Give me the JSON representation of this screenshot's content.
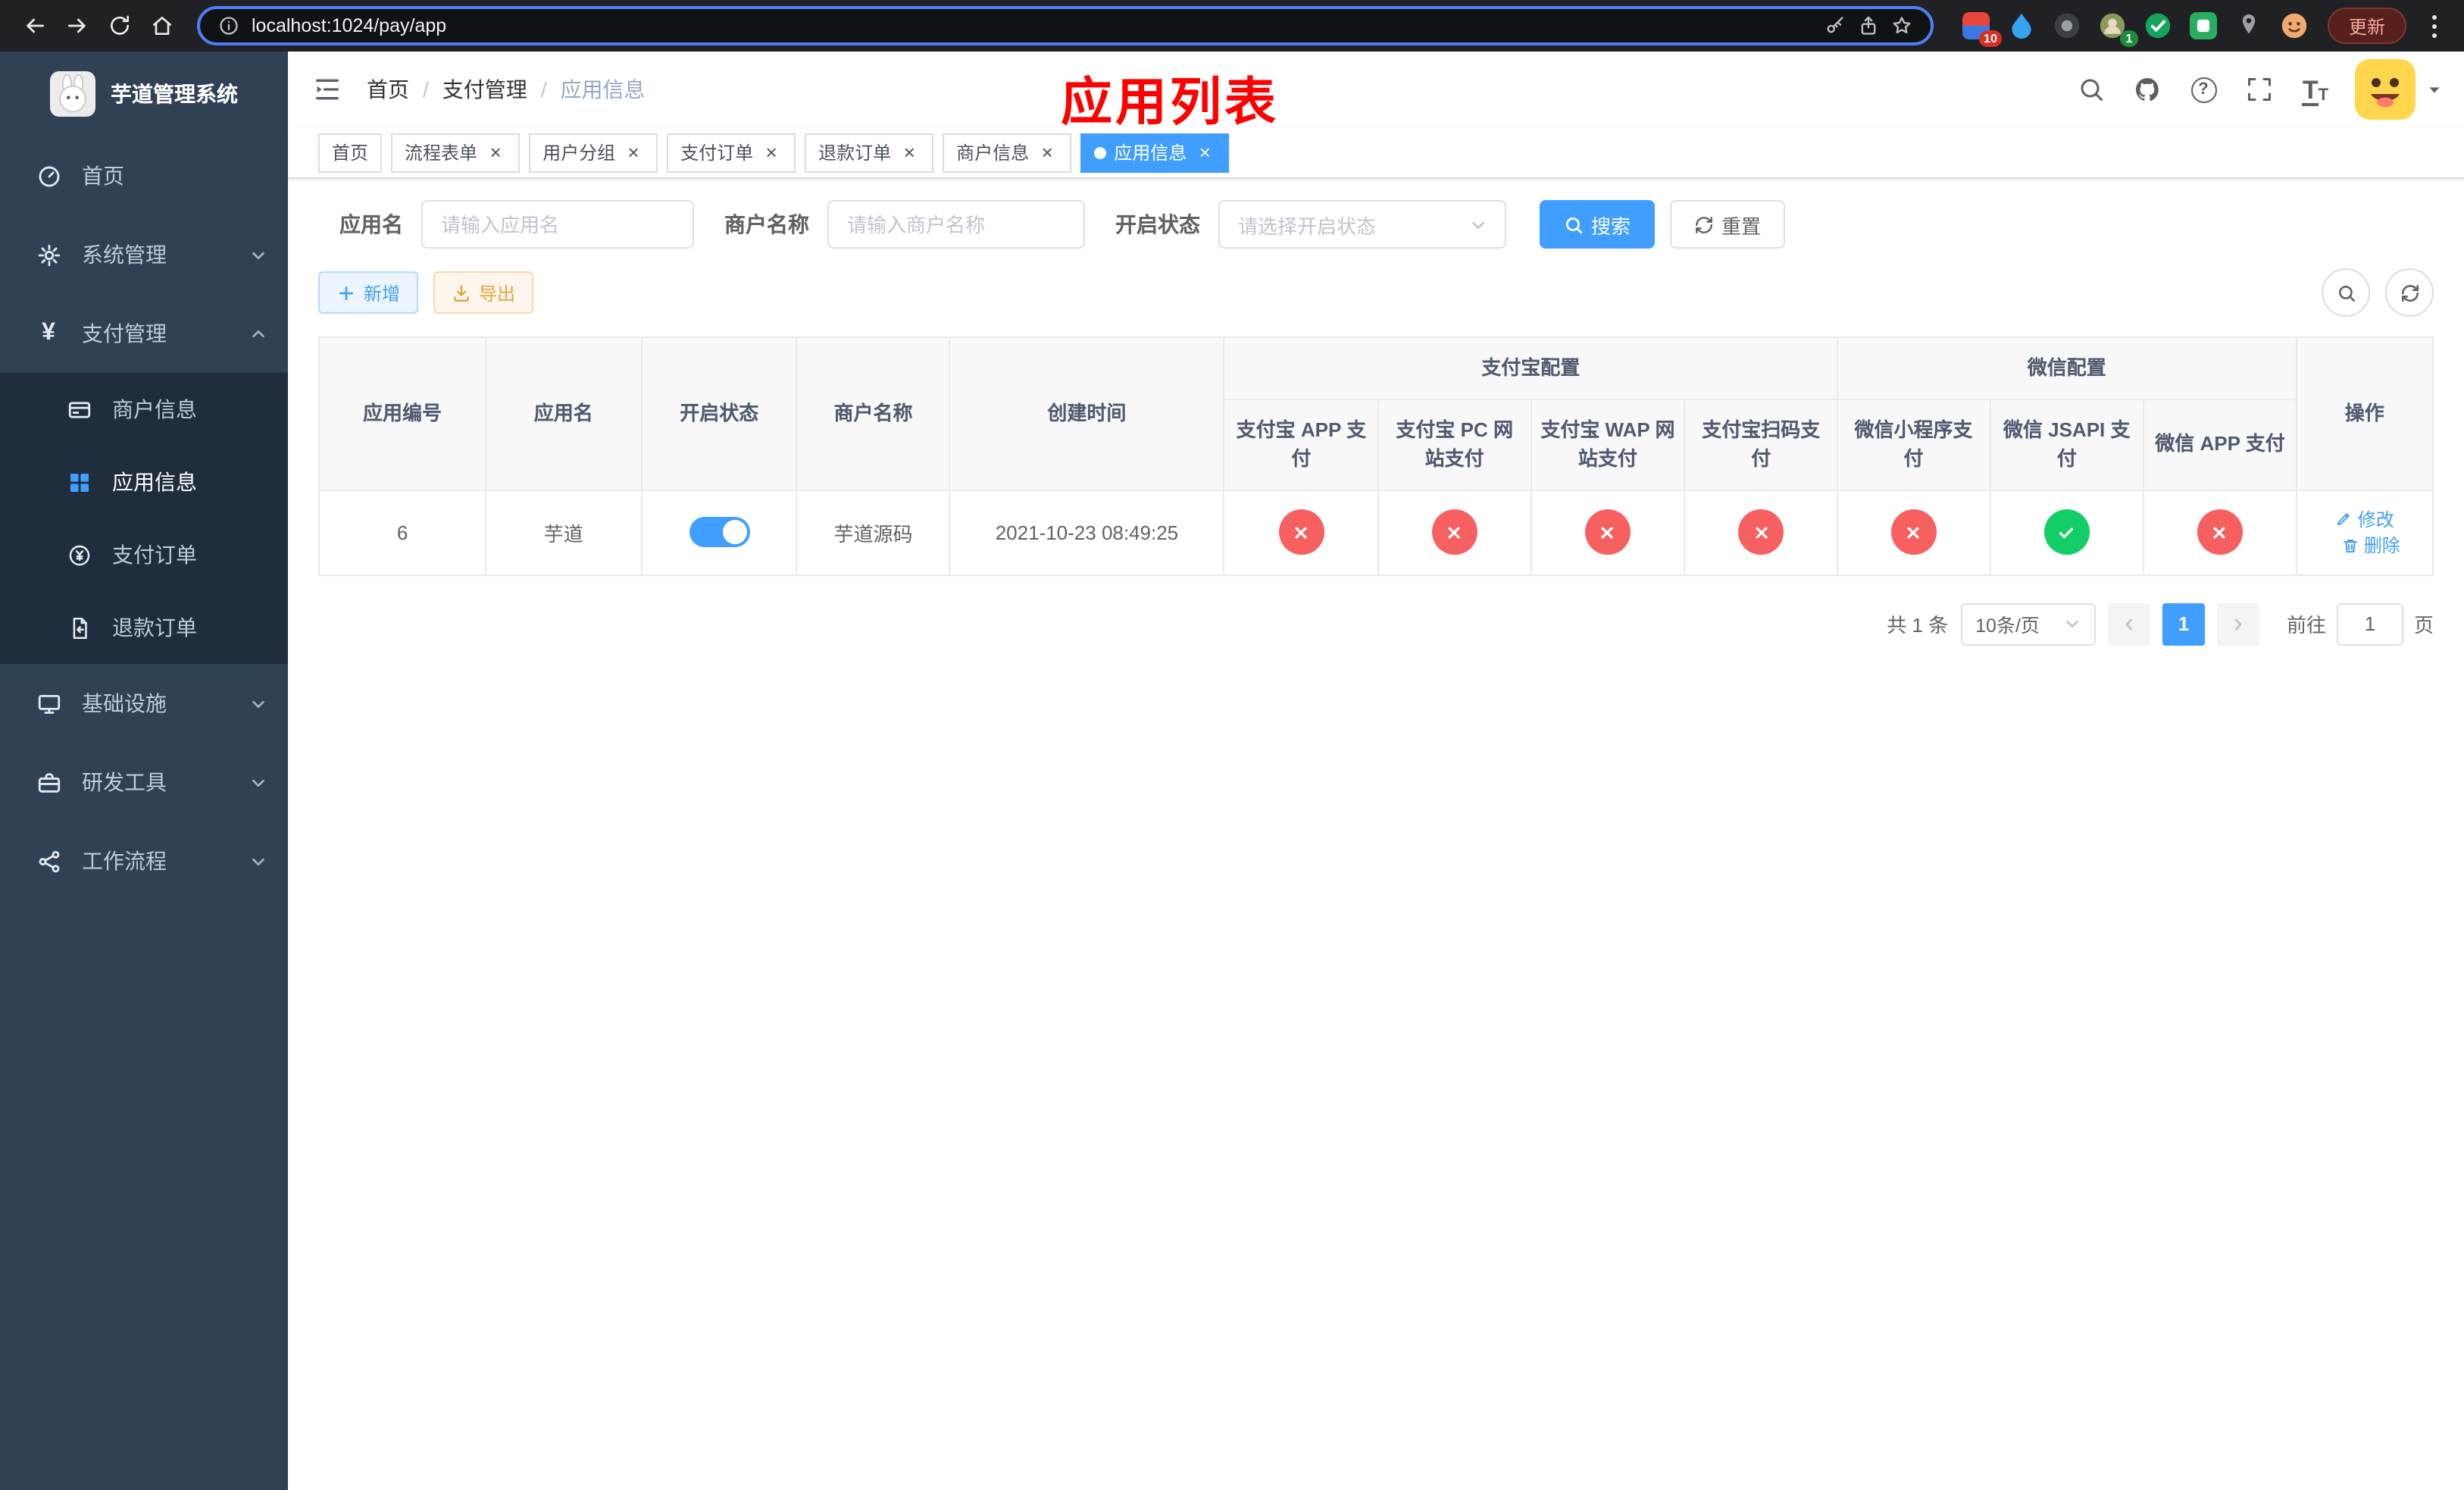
{
  "colors": {
    "accent": "#409eff",
    "success": "#13ce66",
    "danger": "#f76060",
    "warning": "#e6a23c",
    "sidebar-bg": "#304156",
    "submenu-bg": "#1f2d3d",
    "annotation": "#ff0000"
  },
  "icons": {
    "close": "×",
    "yen": "¥",
    "question": "?",
    "font": "T",
    "breadcrumb_sep": "/"
  },
  "browser": {
    "url": "localhost:1024/pay/app",
    "update_label": "更新",
    "ext_badges": [
      "10",
      "1"
    ]
  },
  "annotation": "应用列表",
  "sidebar": {
    "title": "芋道管理系统",
    "menu": [
      {
        "label": "首页"
      },
      {
        "label": "系统管理"
      },
      {
        "label": "支付管理",
        "children": [
          {
            "label": "商户信息"
          },
          {
            "label": "应用信息",
            "active": true
          },
          {
            "label": "支付订单"
          },
          {
            "label": "退款订单"
          }
        ]
      },
      {
        "label": "基础设施"
      },
      {
        "label": "研发工具"
      },
      {
        "label": "工作流程"
      }
    ]
  },
  "header": {
    "breadcrumb": [
      "首页",
      "支付管理",
      "应用信息"
    ]
  },
  "tags": [
    {
      "label": "首页",
      "closable": false,
      "active": false
    },
    {
      "label": "流程表单",
      "closable": true,
      "active": false
    },
    {
      "label": "用户分组",
      "closable": true,
      "active": false
    },
    {
      "label": "支付订单",
      "closable": true,
      "active": false
    },
    {
      "label": "退款订单",
      "closable": true,
      "active": false
    },
    {
      "label": "商户信息",
      "closable": true,
      "active": false
    },
    {
      "label": "应用信息",
      "closable": true,
      "active": true
    }
  ],
  "filters": {
    "app_name_label": "应用名",
    "app_name_placeholder": "请输入应用名",
    "merchant_label": "商户名称",
    "merchant_placeholder": "请输入商户名称",
    "status_label": "开启状态",
    "status_placeholder": "请选择开启状态",
    "search_label": "搜索",
    "reset_label": "重置"
  },
  "toolbar": {
    "add_label": "新增",
    "export_label": "导出"
  },
  "table": {
    "main_headers": [
      "应用编号",
      "应用名",
      "开启状态",
      "商户名称",
      "创建时间"
    ],
    "groups": [
      {
        "label": "支付宝配置",
        "columns": [
          "支付宝 APP 支付",
          "支付宝 PC 网站支付",
          "支付宝 WAP 网站支付",
          "支付宝扫码支付"
        ]
      },
      {
        "label": "微信配置",
        "columns": [
          "微信小程序支付",
          "微信 JSAPI 支付",
          "微信 APP 支付"
        ]
      }
    ],
    "ops_header": "操作",
    "rows": [
      {
        "id": "6",
        "name": "芋道",
        "enabled": true,
        "merchant": "芋道源码",
        "created": "2021-10-23 08:49:25",
        "configs": [
          "no",
          "no",
          "no",
          "no",
          "no",
          "yes",
          "no"
        ],
        "actions": [
          "修改",
          "删除"
        ]
      }
    ]
  },
  "pagination": {
    "total": "共 1 条",
    "page_size": "10条/页",
    "page": "1",
    "goto_label": "前往",
    "goto_value": "1",
    "page_unit": "页"
  }
}
